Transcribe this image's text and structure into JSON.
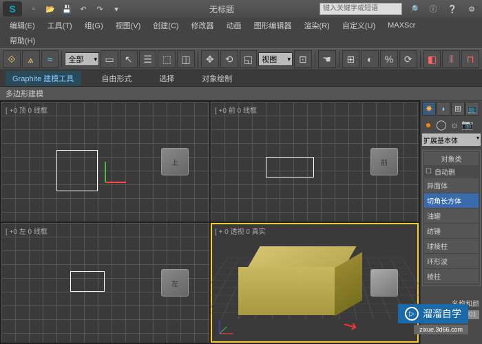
{
  "title": "无标题",
  "search_placeholder": "键入关键字或短语",
  "menus": [
    "编辑(E)",
    "工具(T)",
    "组(G)",
    "视图(V)",
    "创建(C)",
    "修改器",
    "动画",
    "图形编辑器",
    "渲染(R)",
    "自定义(U)",
    "MAXScr"
  ],
  "menus2": [
    "帮助(H)"
  ],
  "toolbar_dd1": "全部",
  "toolbar_dd2": "视图",
  "ribbon_tabs": [
    "Graphite 建模工具",
    "自由形式",
    "选择",
    "对象绘制"
  ],
  "ribbon_panel": "多边形建模",
  "viewports": {
    "top_left": "[ +0 顶 0 线框",
    "top_right": "[ +0 前 0 线框",
    "bottom_left": "[ +0 左 0 线框",
    "bottom_right": "[ + 0 透视 0 真实"
  },
  "view_cubes": {
    "tl": "上",
    "tr": "前",
    "bl": "左",
    "br": ""
  },
  "command_panel": {
    "dropdown": "扩展基本体",
    "section_title": "对象类",
    "autofit": "自动删",
    "items": [
      "异面体",
      "切角长方体",
      "油罐",
      "纺锤",
      "球棱柱",
      "环形波",
      "棱柱"
    ],
    "active_item": "切角长方体",
    "name_label": "名称和颜",
    "obj_name": "Box001"
  },
  "watermark": "溜溜自学",
  "watermark_sub": "zixue.3d66.com"
}
